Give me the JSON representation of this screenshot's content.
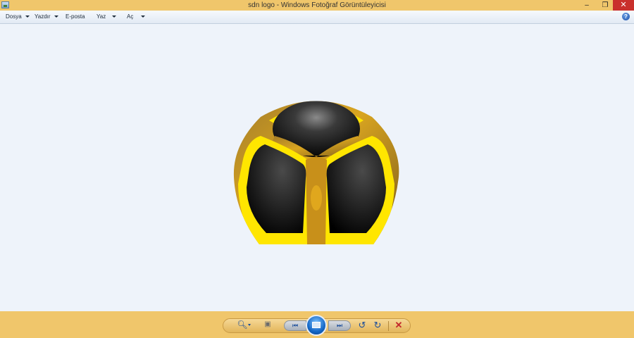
{
  "window": {
    "title": "sdn logo - Windows Fotoğraf Görüntüleyicisi",
    "controls": {
      "minimize": "–",
      "restore": "❐",
      "close": "✕"
    }
  },
  "menu": {
    "items": [
      {
        "label": "Dosya",
        "has_dropdown": true
      },
      {
        "label": "Yazdır",
        "has_dropdown": true
      },
      {
        "label": "E-posta",
        "has_dropdown": false
      },
      {
        "label": "Yaz",
        "has_dropdown": true
      },
      {
        "label": "Aç",
        "has_dropdown": true
      }
    ],
    "help": "?"
  },
  "image": {
    "alt": "sdn logo"
  },
  "toolbar": {
    "zoom_icon": "magnifier-icon",
    "fit_icon": "fit-to-window-icon",
    "prev_icon": "previous-icon",
    "slideshow_icon": "slideshow-icon",
    "next_icon": "next-icon",
    "rotate_left_icon": "rotate-counterclockwise-icon",
    "rotate_right_icon": "rotate-clockwise-icon",
    "delete_icon": "delete-icon"
  },
  "colors": {
    "titlebar": "#f0c66b",
    "bottombar": "#f0c66b",
    "canvas": "#eef3fa",
    "close_button": "#c9302c",
    "accent_blue": "#1b4e9b"
  }
}
